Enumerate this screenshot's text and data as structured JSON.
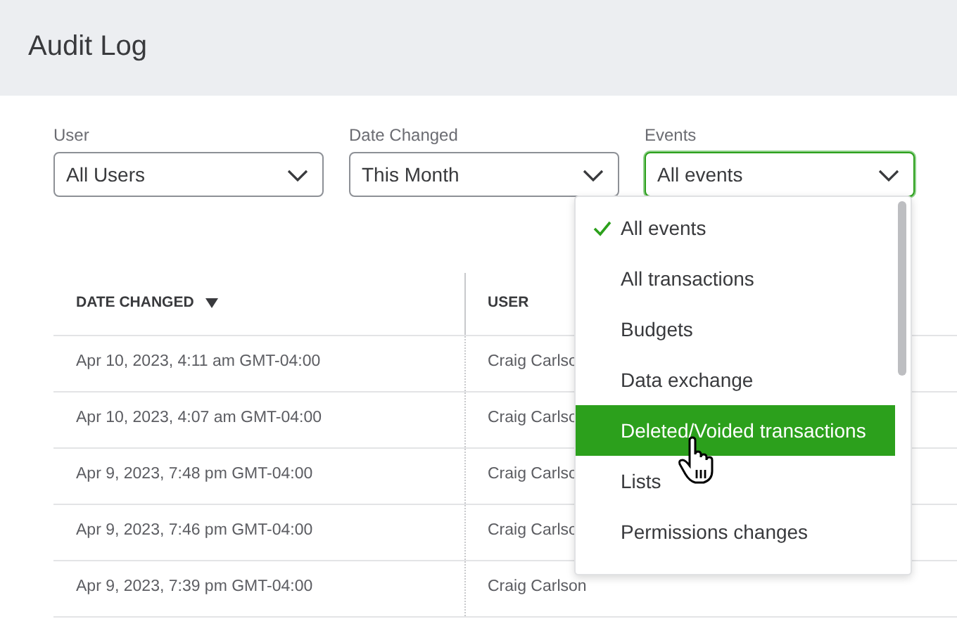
{
  "page": {
    "title": "Audit Log"
  },
  "filters": [
    {
      "label": "User",
      "value": "All Users",
      "focused": false
    },
    {
      "label": "Date Changed",
      "value": "This Month",
      "focused": false
    },
    {
      "label": "Events",
      "value": "All events",
      "focused": true
    }
  ],
  "events_menu": {
    "expanded": true,
    "options": [
      {
        "label": "All events",
        "selected": true,
        "highlighted": false
      },
      {
        "label": "All transactions",
        "selected": false,
        "highlighted": false
      },
      {
        "label": "Budgets",
        "selected": false,
        "highlighted": false
      },
      {
        "label": "Data exchange",
        "selected": false,
        "highlighted": false
      },
      {
        "label": "Deleted/Voided transactions",
        "selected": false,
        "highlighted": true
      },
      {
        "label": "Lists",
        "selected": false,
        "highlighted": false
      },
      {
        "label": "Permissions changes",
        "selected": false,
        "highlighted": false
      }
    ]
  },
  "table": {
    "columns": [
      {
        "label": "DATE CHANGED",
        "sorted": true
      },
      {
        "label": "USER",
        "sorted": false
      }
    ],
    "rows": [
      [
        "Apr 10, 2023, 4:11 am GMT-04:00",
        "Craig Carlso"
      ],
      [
        "Apr 10, 2023, 4:07 am GMT-04:00",
        "Craig Carlso"
      ],
      [
        "Apr 9, 2023, 7:48 pm GMT-04:00",
        "Craig Carlso"
      ],
      [
        "Apr 9, 2023, 7:46 pm GMT-04:00",
        "Craig Carlso"
      ],
      [
        "Apr 9, 2023, 7:39 pm GMT-04:00",
        "Craig Carlson"
      ]
    ]
  }
}
